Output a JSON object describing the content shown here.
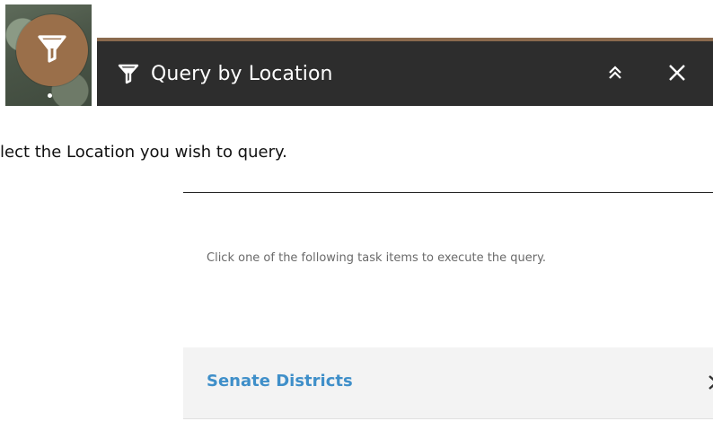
{
  "panel": {
    "title": "Query by Location"
  },
  "instruction": "lect the Location you wish to query.",
  "task_list": {
    "description": "Click one of the following task items to execute the query.",
    "items": [
      {
        "label": "Senate Districts"
      }
    ]
  },
  "colors": {
    "header_bg": "#2d2d2d",
    "header_accent": "#8a6a4e",
    "launcher_bg": "#9a6f4a",
    "task_link": "#3f8fc9",
    "task_bg": "#f3f3f3"
  },
  "icons": {
    "launcher": "filter-icon",
    "header": "filter-icon",
    "collapse": "double-chevron-up-icon",
    "close": "close-icon",
    "task_item": "chevron-right-icon"
  }
}
